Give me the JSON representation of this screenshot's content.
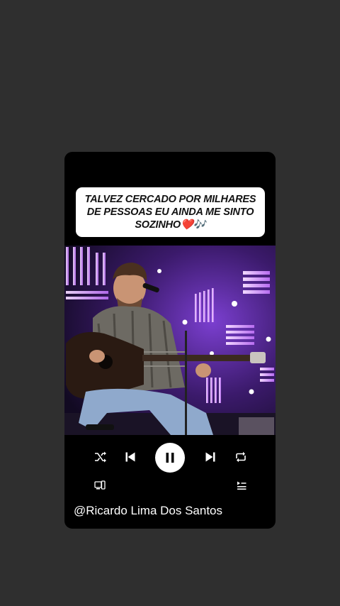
{
  "caption": {
    "text": "TALVEZ CERCADO POR MILHARES DE PESSOAS EU AINDA ME SINTO SOZINHO❤️🎶"
  },
  "player": {
    "state": "playing",
    "controls": [
      "shuffle-icon",
      "previous-icon",
      "pause-icon",
      "next-icon",
      "repeat-icon"
    ],
    "secondary": [
      "devices-icon",
      "queue-icon"
    ]
  },
  "credit": {
    "handle": "@Ricardo Lima Dos Santos"
  },
  "colors": {
    "background": "#2f2f2f",
    "card": "#000000",
    "caption_bg": "#ffffff",
    "stage_purple": "#8a3fd1"
  }
}
